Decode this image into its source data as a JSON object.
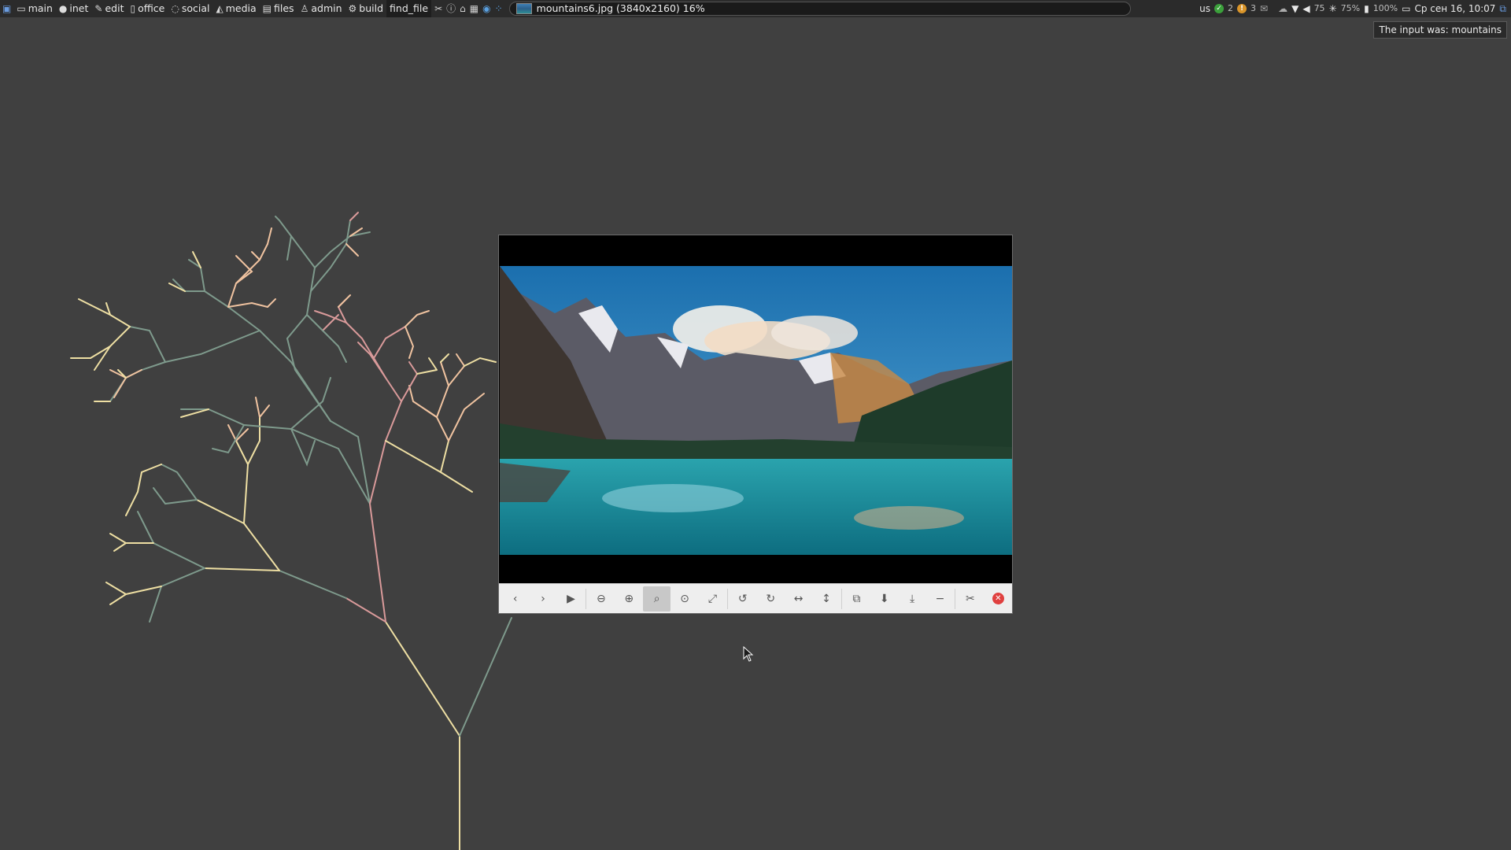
{
  "panel": {
    "workspaces": [
      {
        "label": "main",
        "icon": "monitor-icon"
      },
      {
        "label": "inet",
        "icon": "globe-icon"
      },
      {
        "label": "edit",
        "icon": "edit-icon"
      },
      {
        "label": "office",
        "icon": "document-icon"
      },
      {
        "label": "social",
        "icon": "chat-icon"
      },
      {
        "label": "media",
        "icon": "image-icon"
      },
      {
        "label": "files",
        "icon": "folder-icon"
      },
      {
        "label": "admin",
        "icon": "user-icon"
      },
      {
        "label": "build",
        "icon": "gears-icon"
      },
      {
        "label": "find_file",
        "icon": ""
      }
    ],
    "window_title": "mountains6.jpg (3840x2160) 16%",
    "tray": {
      "keyboard_layout": "us",
      "badge_green": "2",
      "badge_orange": "3",
      "volume": "75",
      "brightness": "75%",
      "battery": "100%",
      "datetime": "Ср сен 16, 10:07"
    }
  },
  "notification": "The input was: mountains",
  "viewer": {
    "toolbar_buttons": [
      "previous-button",
      "next-button",
      "slideshow-button",
      "zoom-out-button",
      "zoom-in-button",
      "zoom-original-button",
      "zoom-fit-button",
      "fullscreen-button",
      "rotate-left-button",
      "rotate-right-button",
      "flip-horizontal-button",
      "flip-vertical-button",
      "copy-button",
      "save-button",
      "save-as-button",
      "minimize-button",
      "preferences-button",
      "close-button"
    ],
    "pressed_button": "zoom-original-button"
  },
  "colors": {
    "background": "#404040",
    "panel": "#2b2b2b",
    "branch_yellow": "#eedfa3",
    "branch_green": "#7e9a8c",
    "branch_pink": "#d99a9a",
    "branch_peach": "#f0c3a0",
    "close_red": "#e0403f"
  }
}
